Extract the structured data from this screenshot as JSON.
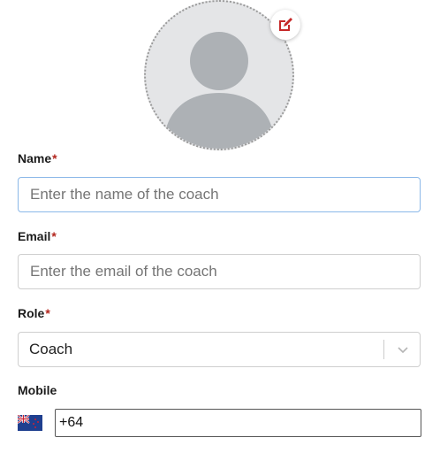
{
  "avatar": {
    "icon": "user-silhouette-icon",
    "edit_icon": "edit-icon",
    "edit_color": "#c62828"
  },
  "form": {
    "name": {
      "label": "Name",
      "required": "*",
      "placeholder": "Enter the name of the coach"
    },
    "email": {
      "label": "Email",
      "required": "*",
      "placeholder": "Enter the email of the coach"
    },
    "role": {
      "label": "Role",
      "required": "*",
      "value": "Coach"
    },
    "mobile": {
      "label": "Mobile",
      "flag": "new-zealand-flag-icon",
      "value": "+64"
    }
  }
}
